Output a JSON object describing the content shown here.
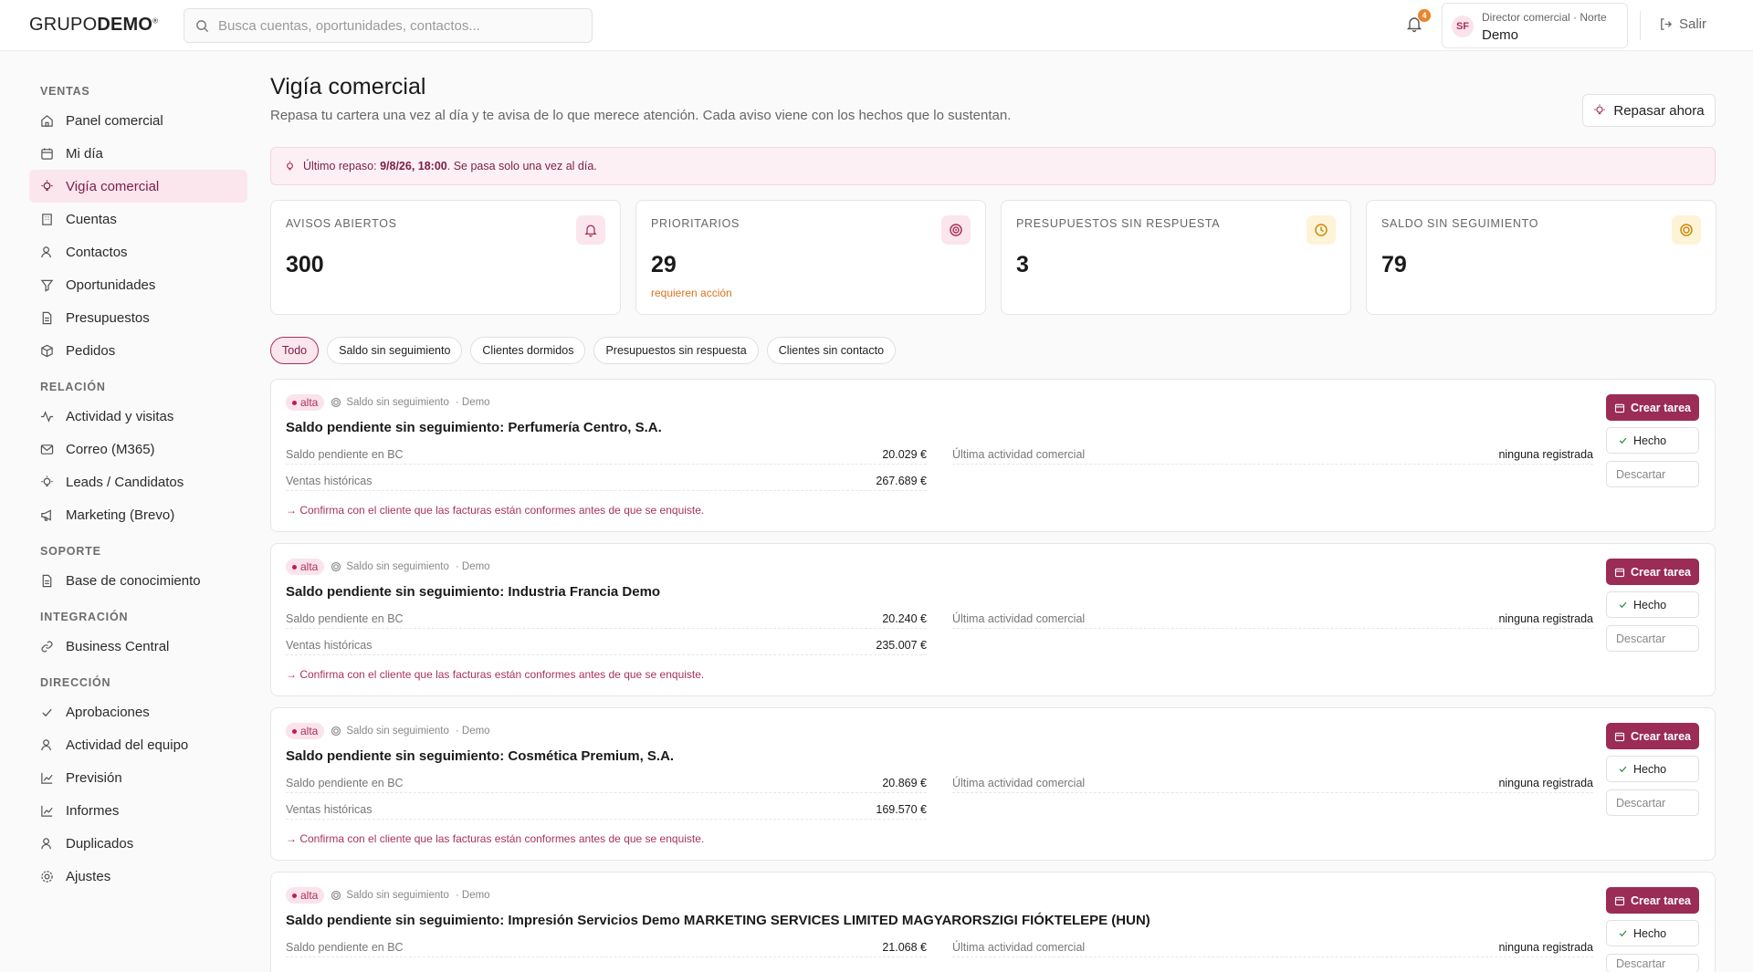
{
  "header": {
    "logo_light": "GRUPO",
    "logo_bold": "DEMO",
    "logo_mark": "®",
    "search_placeholder": "Busca cuentas, oportunidades, contactos...",
    "notifications_count": "4",
    "user_initials": "SF",
    "user_role": "Director comercial · Norte",
    "user_name": "Demo",
    "logout_label": "Salir"
  },
  "sidebar": {
    "sections": [
      {
        "title": "VENTAS",
        "items": [
          {
            "label": "Panel comercial",
            "icon": "home-icon"
          },
          {
            "label": "Mi día",
            "icon": "calendar-icon"
          },
          {
            "label": "Vigía comercial",
            "icon": "lightbulb-icon",
            "active": true
          },
          {
            "label": "Cuentas",
            "icon": "building-icon"
          },
          {
            "label": "Contactos",
            "icon": "contacts-icon"
          },
          {
            "label": "Oportunidades",
            "icon": "funnel-icon"
          },
          {
            "label": "Presupuestos",
            "icon": "document-icon"
          },
          {
            "label": "Pedidos",
            "icon": "box-icon"
          }
        ]
      },
      {
        "title": "RELACIÓN",
        "items": [
          {
            "label": "Actividad y visitas",
            "icon": "activity-icon"
          },
          {
            "label": "Correo (M365)",
            "icon": "mail-icon"
          },
          {
            "label": "Leads / Candidatos",
            "icon": "lightbulb-icon"
          },
          {
            "label": "Marketing (Brevo)",
            "icon": "megaphone-icon"
          }
        ]
      },
      {
        "title": "SOPORTE",
        "items": [
          {
            "label": "Base de conocimiento",
            "icon": "document-icon"
          }
        ]
      },
      {
        "title": "INTEGRACIÓN",
        "items": [
          {
            "label": "Business Central",
            "icon": "link-icon"
          }
        ]
      },
      {
        "title": "DIRECCIÓN",
        "items": [
          {
            "label": "Aprobaciones",
            "icon": "check-icon"
          },
          {
            "label": "Actividad del equipo",
            "icon": "contacts-icon"
          },
          {
            "label": "Previsión",
            "icon": "chart-icon"
          },
          {
            "label": "Informes",
            "icon": "chart-icon"
          },
          {
            "label": "Duplicados",
            "icon": "contacts-icon"
          },
          {
            "label": "Ajustes",
            "icon": "gear-icon"
          }
        ]
      }
    ]
  },
  "page": {
    "title": "Vigía comercial",
    "subtitle": "Repasa tu cartera una vez al día y te avisa de lo que merece atención. Cada aviso viene con los hechos que lo sustentan.",
    "review_button": "Repasar ahora",
    "banner_prefix": "Último repaso:",
    "banner_date": "9/8/26, 18:00",
    "banner_suffix": ". Se pasa solo una vez al día."
  },
  "kpis": [
    {
      "label": "AVISOS ABIERTOS",
      "value": "300",
      "note": "",
      "icon": "bell-icon",
      "bg": "#fbe6ee",
      "color": "#a8325a"
    },
    {
      "label": "PRIORITARIOS",
      "value": "29",
      "note": "requieren acción",
      "icon": "target-icon",
      "bg": "#fbe6ee",
      "color": "#a8325a"
    },
    {
      "label": "PRESUPUESTOS SIN RESPUESTA",
      "value": "3",
      "note": "",
      "icon": "clock-icon",
      "bg": "#fdf3d6",
      "color": "#c98a10"
    },
    {
      "label": "SALDO SIN SEGUIMIENTO",
      "value": "79",
      "note": "",
      "icon": "coin-icon",
      "bg": "#fdf3d6",
      "color": "#c98a10"
    }
  ],
  "filters": [
    {
      "label": "Todo",
      "active": true
    },
    {
      "label": "Saldo sin seguimiento"
    },
    {
      "label": "Clientes dormidos"
    },
    {
      "label": "Presupuestos sin respuesta"
    },
    {
      "label": "Clientes sin contacto"
    }
  ],
  "alerts": [
    {
      "priority": "alta",
      "type": "Saldo sin seguimiento",
      "source": "· Demo",
      "title": "Saldo pendiente sin seguimiento: Perfumería Centro, S.A.",
      "balance_label": "Saldo pendiente en BC",
      "balance": "20.029 €",
      "sales_label": "Ventas históricas",
      "sales": "267.689 €",
      "activity_label": "Última actividad comercial",
      "activity": "ninguna registrada",
      "hint": "→ Confirma con el cliente que las facturas están conformes antes de que se enquiste."
    },
    {
      "priority": "alta",
      "type": "Saldo sin seguimiento",
      "source": "· Demo",
      "title": "Saldo pendiente sin seguimiento: Industria Francia Demo",
      "balance_label": "Saldo pendiente en BC",
      "balance": "20.240 €",
      "sales_label": "Ventas históricas",
      "sales": "235.007 €",
      "activity_label": "Última actividad comercial",
      "activity": "ninguna registrada",
      "hint": "→ Confirma con el cliente que las facturas están conformes antes de que se enquiste."
    },
    {
      "priority": "alta",
      "type": "Saldo sin seguimiento",
      "source": "· Demo",
      "title": "Saldo pendiente sin seguimiento: Cosmética Premium, S.A.",
      "balance_label": "Saldo pendiente en BC",
      "balance": "20.869 €",
      "sales_label": "Ventas históricas",
      "sales": "169.570 €",
      "activity_label": "Última actividad comercial",
      "activity": "ninguna registrada",
      "hint": "→ Confirma con el cliente que las facturas están conformes antes de que se enquiste."
    },
    {
      "priority": "alta",
      "type": "Saldo sin seguimiento",
      "source": "· Demo",
      "title": "Saldo pendiente sin seguimiento: Impresión Servicios Demo MARKETING SERVICES LIMITED MAGYARORSZIGI FIÓKTELEPE (HUN)",
      "balance_label": "Saldo pendiente en BC",
      "balance": "21.068 €",
      "sales_label": "",
      "sales": "",
      "activity_label": "Última actividad comercial",
      "activity": "ninguna registrada",
      "hint": ""
    }
  ],
  "actions": {
    "create_task": "Crear tarea",
    "done": "Hecho",
    "discard": "Descartar"
  },
  "colors": {
    "accent": "#9a2c56",
    "accent_soft": "#fbe6ee",
    "warning": "#d9731e"
  }
}
